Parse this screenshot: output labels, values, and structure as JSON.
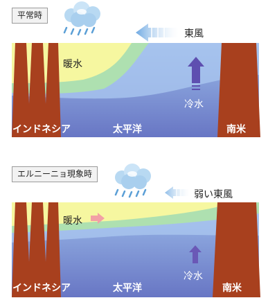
{
  "panels": [
    {
      "title": "平常時",
      "wind_label": "東風",
      "warm_label": "暖水",
      "cold_label": "冷水",
      "left_label": "インドネシア",
      "center_label": "太平洋",
      "right_label": "南米"
    },
    {
      "title": "エルニーニョ現象時",
      "wind_label": "弱い東風",
      "warm_label": "暖水",
      "cold_label": "冷水",
      "left_label": "インドネシア",
      "center_label": "太平洋",
      "right_label": "南米"
    }
  ],
  "colors": {
    "land": "#a8401e",
    "ocean_deep": "#6f7fc9",
    "ocean_light": "#93b5e6",
    "warm": "#f4f59b",
    "warm_edge": "#a9dfa0",
    "cold_arrow": "#6a58b6",
    "wind_arrow": "#9cc7ec",
    "warm_arrow": "#f2a0a5"
  }
}
